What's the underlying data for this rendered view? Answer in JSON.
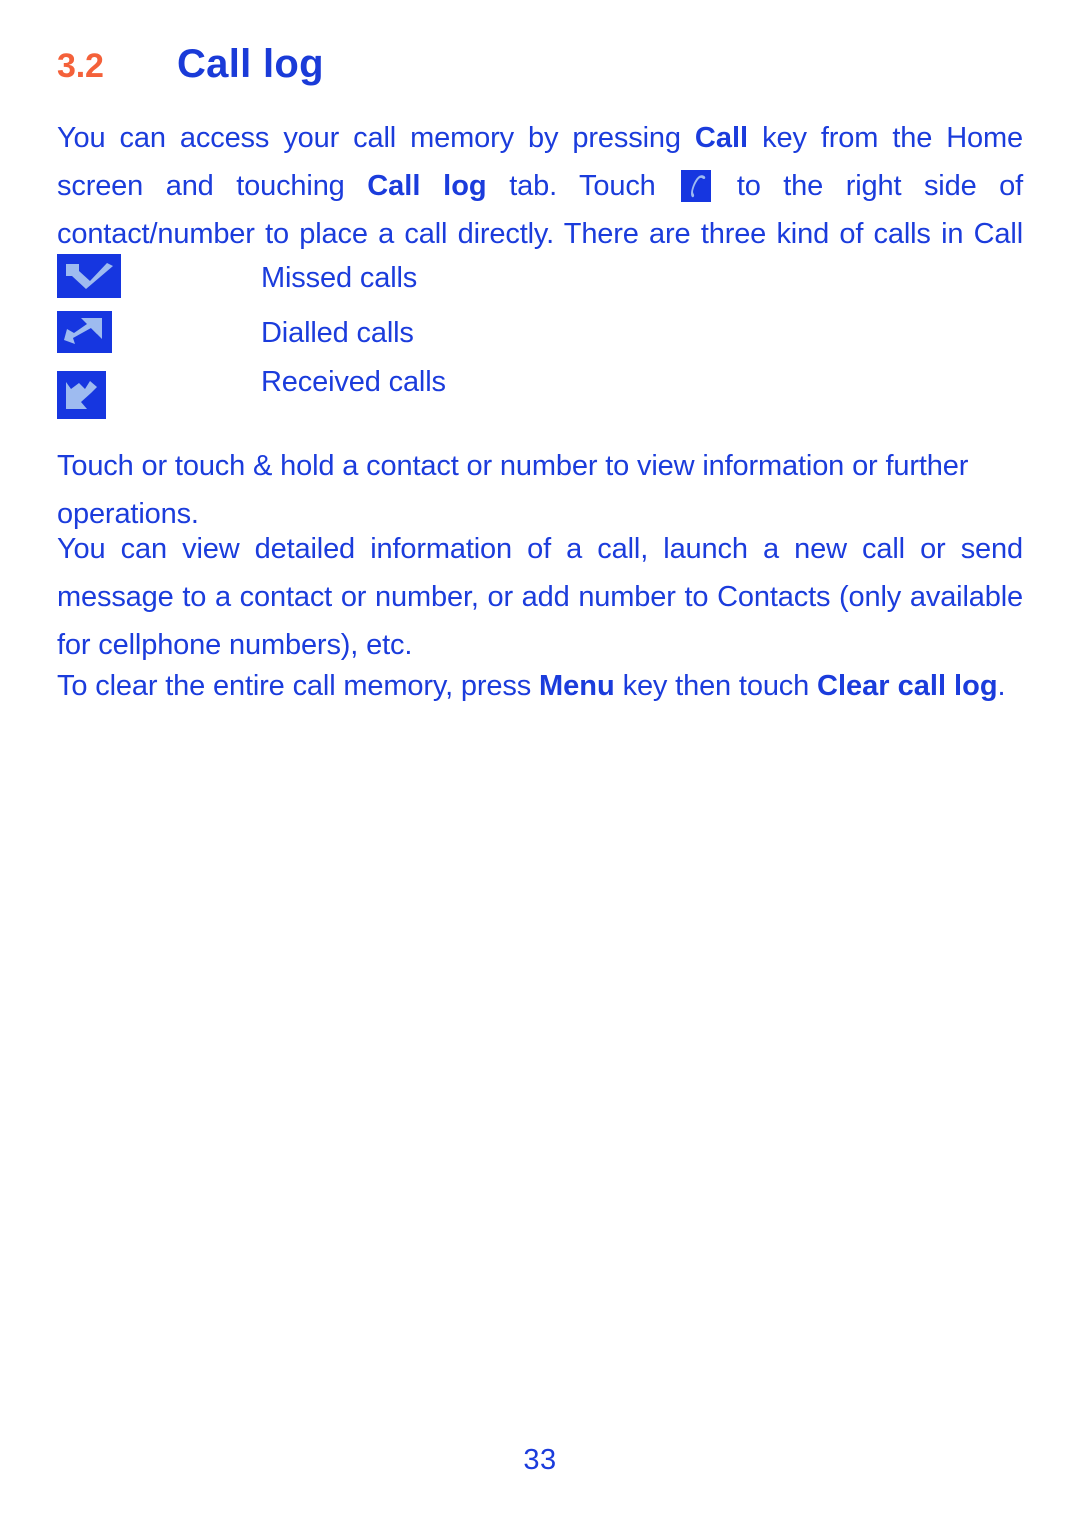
{
  "document": {
    "page_number": "33",
    "colors": {
      "heading_number": "#F4613A",
      "heading_title": "#1A3BD8",
      "body_text": "#1B3CDC",
      "icon_background": "#1636E0",
      "icon_glyph": "#9EBBF0",
      "page_background": "#FFFFFF"
    }
  },
  "heading": {
    "number": "3.2",
    "title": "Call log"
  },
  "paragraphs": {
    "intro": {
      "part1": "You can access your call memory by pressing ",
      "bold1": "Call",
      "part2": " key from the Home screen and touching ",
      "bold2": "Call log",
      "part3": " tab. Touch ",
      "icon": "phone-handset-icon",
      "part4": " to the right side of contact/number to place a call directly. There are three kind of calls in Call log:"
    },
    "touch_hold": "Touch or touch & hold a contact or number to view information or further operations.",
    "view_details": "You can view detailed information of a call, launch a new call or send message to a contact or number, or add number to Contacts (only available for cellphone numbers), etc.",
    "clear_log": {
      "part1": "To clear the entire call memory, press ",
      "bold1": "Menu",
      "part2": " key then touch ",
      "bold2": "Clear call log",
      "part3": "."
    }
  },
  "call_types": [
    {
      "icon": "missed-call-icon",
      "label": "Missed calls"
    },
    {
      "icon": "dialled-call-icon",
      "label": "Dialled calls"
    },
    {
      "icon": "received-call-icon",
      "label": "Received calls"
    }
  ]
}
